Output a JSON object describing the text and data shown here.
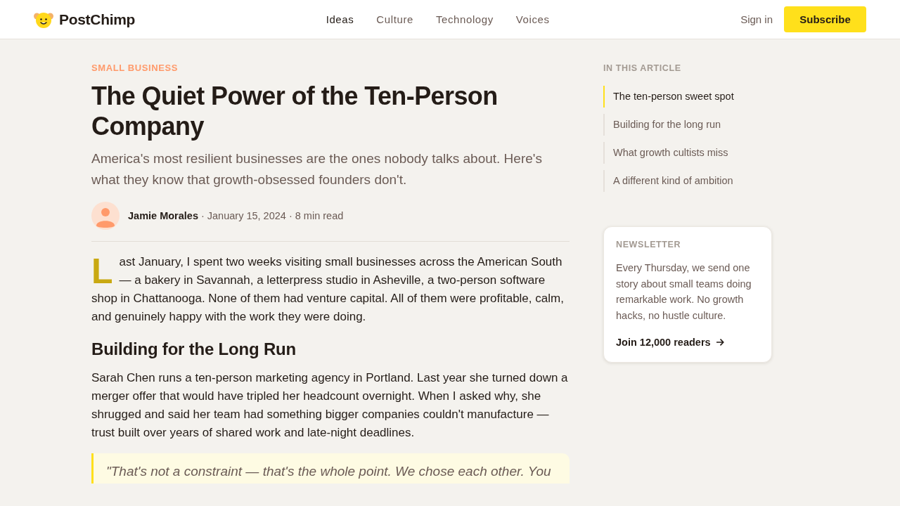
{
  "header": {
    "logo": "PostChimp",
    "nav": [
      {
        "label": "Ideas",
        "selected": true
      },
      {
        "label": "Culture",
        "selected": false
      },
      {
        "label": "Technology",
        "selected": false
      },
      {
        "label": "Voices",
        "selected": false
      }
    ],
    "sign_in": "Sign in",
    "subscribe": "Subscribe"
  },
  "article": {
    "category": "SMALL BUSINESS",
    "title": "The Quiet Power of the Ten-Person Company",
    "subtitle": "America's most resilient businesses are the ones nobody talks about. Here's what they know that growth-obsessed founders don't.",
    "author": "Jamie Morales",
    "meta": "· January 15, 2024 · 8 min read",
    "body": [
      {
        "kind": "paragraph",
        "drop_cap": true,
        "text": "Last January, I spent two weeks visiting small businesses across the American South — a bakery in Savannah, a letterpress studio in Asheville, a two-person software shop in Chattanooga. None of them had venture capital. All of them were profitable, calm, and genuinely happy with the work they were doing."
      },
      {
        "kind": "heading",
        "text": "Building for the Long Run"
      },
      {
        "kind": "paragraph",
        "drop_cap": false,
        "text": "Sarah Chen runs a ten-person marketing agency in Portland. Last year she turned down a merger offer that would have tripled her headcount overnight. When I asked why, she shrugged and said her team had something bigger companies couldn't manufacture — trust built over years of shared work and late-night deadlines."
      },
      {
        "kind": "quote",
        "text": "\"That's not a constraint — that's the whole point. We chose each other. You"
      }
    ]
  },
  "sidebar": {
    "toc": {
      "title": "IN THIS ARTICLE",
      "items": [
        {
          "label": "The ten-person sweet spot",
          "selected": true
        },
        {
          "label": "Building for the long run",
          "selected": false
        },
        {
          "label": "What growth cultists miss",
          "selected": false
        },
        {
          "label": "A different kind of ambition",
          "selected": false
        }
      ]
    },
    "newsletter": {
      "label": "NEWSLETTER",
      "text": "Every Thursday, we send one story about small teams doing remarkable work. No growth hacks, no hustle culture.",
      "link": "Join 12,000 readers"
    }
  }
}
